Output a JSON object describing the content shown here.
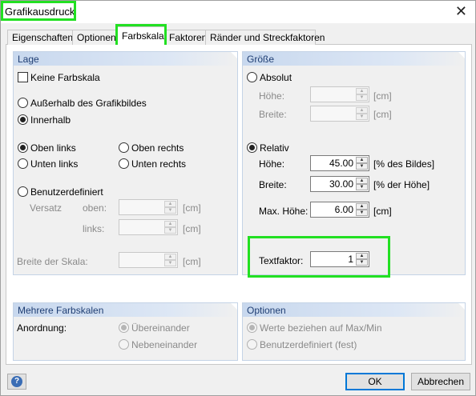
{
  "window": {
    "title": "Grafikausdruck",
    "close_glyph": "✕"
  },
  "tabs": [
    {
      "label": "Eigenschaften"
    },
    {
      "label": "Optionen"
    },
    {
      "label": "Farbskala"
    },
    {
      "label": "Faktoren"
    },
    {
      "label": "Ränder und Streckfaktoren"
    }
  ],
  "lage": {
    "header": "Lage",
    "no_scale": "Keine Farbskala",
    "outside": "Außerhalb des Grafikbildes",
    "inside": "Innerhalb",
    "top_left": "Oben links",
    "top_right": "Oben rechts",
    "bottom_left": "Unten links",
    "bottom_right": "Unten rechts",
    "custom": "Benutzerdefiniert",
    "offset": "Versatz",
    "top": "oben:",
    "left": "links:",
    "scale_width": "Breite der Skala:",
    "unit": "[cm]"
  },
  "groesse": {
    "header": "Größe",
    "absolute": "Absolut",
    "abs_height": "Höhe:",
    "abs_width": "Breite:",
    "unit_cm": "[cm]",
    "relative": "Relativ",
    "rel_height": "Höhe:",
    "rel_height_value": "45.00",
    "rel_height_unit": "[% des Bildes]",
    "rel_width": "Breite:",
    "rel_width_value": "30.00",
    "rel_width_unit": "[% der Höhe]",
    "max_height": "Max. Höhe:",
    "max_height_value": "6.00",
    "max_height_unit": "[cm]",
    "text_factor": "Textfaktor:",
    "text_factor_value": "1"
  },
  "mehrere": {
    "header": "Mehrere Farbskalen",
    "arrangement": "Anordnung:",
    "stacked": "Übereinander",
    "side_by_side": "Nebeneinander"
  },
  "optionen": {
    "header": "Optionen",
    "max_min": "Werte beziehen auf Max/Min",
    "custom_fixed": "Benutzerdefiniert (fest)"
  },
  "buttons": {
    "ok": "OK",
    "cancel": "Abbrechen",
    "help": "?"
  },
  "colors": {
    "highlight": "#22e022",
    "group_header_text": "#1f3e73",
    "ok_border": "#0078d7"
  }
}
